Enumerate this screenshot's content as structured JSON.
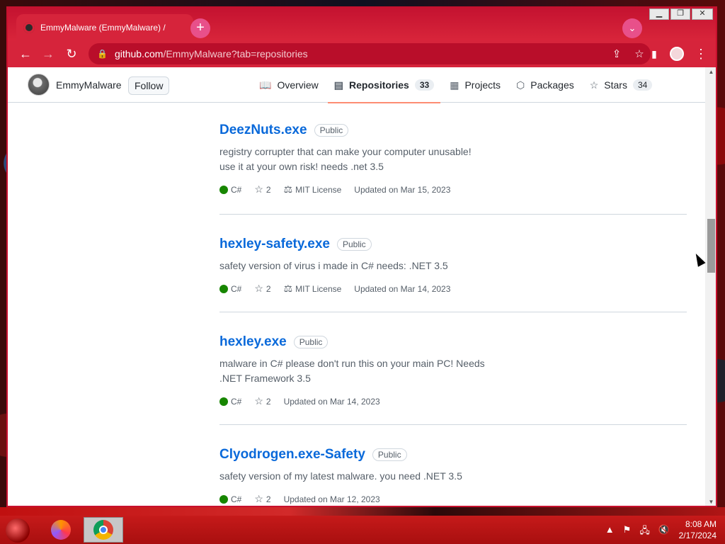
{
  "browser": {
    "tab_title": "EmmyMalware (EmmyMalware) /",
    "new_tab_symbol": "+",
    "tab_search_symbol": "⌄",
    "url_host": "github.com",
    "url_path": "/EmmyMalware?tab=repositories",
    "window_controls": [
      "minimize",
      "restore",
      "close"
    ]
  },
  "profile": {
    "username": "EmmyMalware",
    "follow_label": "Follow"
  },
  "nav": {
    "tabs": [
      {
        "label": "Overview",
        "icon": "book-icon",
        "count": "",
        "active": false
      },
      {
        "label": "Repositories",
        "icon": "repo-icon",
        "count": "33",
        "active": true
      },
      {
        "label": "Projects",
        "icon": "table-icon",
        "count": "",
        "active": false
      },
      {
        "label": "Packages",
        "icon": "package-icon",
        "count": "",
        "active": false
      },
      {
        "label": "Stars",
        "icon": "star-icon",
        "count": "34",
        "active": false
      }
    ]
  },
  "repos": [
    {
      "name": "DeezNuts.exe",
      "visibility": "Public",
      "description": "registry corrupter that can make your computer unusable! use it at your own risk! needs .net 3.5",
      "language": "C#",
      "language_color": "#178600",
      "stars": "2",
      "license": "MIT License",
      "updated": "Updated on Mar 15, 2023"
    },
    {
      "name": "hexley-safety.exe",
      "visibility": "Public",
      "description": "safety version of virus i made in C# needs: .NET 3.5",
      "language": "C#",
      "language_color": "#178600",
      "stars": "2",
      "license": "MIT License",
      "updated": "Updated on Mar 14, 2023"
    },
    {
      "name": "hexley.exe",
      "visibility": "Public",
      "description": "malware in C# please don't run this on your main PC! Needs .NET Framework 3.5",
      "language": "C#",
      "language_color": "#178600",
      "stars": "2",
      "license": "",
      "updated": "Updated on Mar 14, 2023"
    },
    {
      "name": "Clyodrogen.exe-Safety",
      "visibility": "Public",
      "description": "safety version of my latest malware. you need .NET 3.5",
      "language": "C#",
      "language_color": "#178600",
      "stars": "2",
      "license": "",
      "updated": "Updated on Mar 12, 2023"
    }
  ],
  "taskbar": {
    "time": "8:08 AM",
    "date": "2/17/2024"
  },
  "colors": {
    "chrome_theme": "#d6243b",
    "link_blue": "#0969da",
    "active_tab_underline": "#fd8c73"
  }
}
